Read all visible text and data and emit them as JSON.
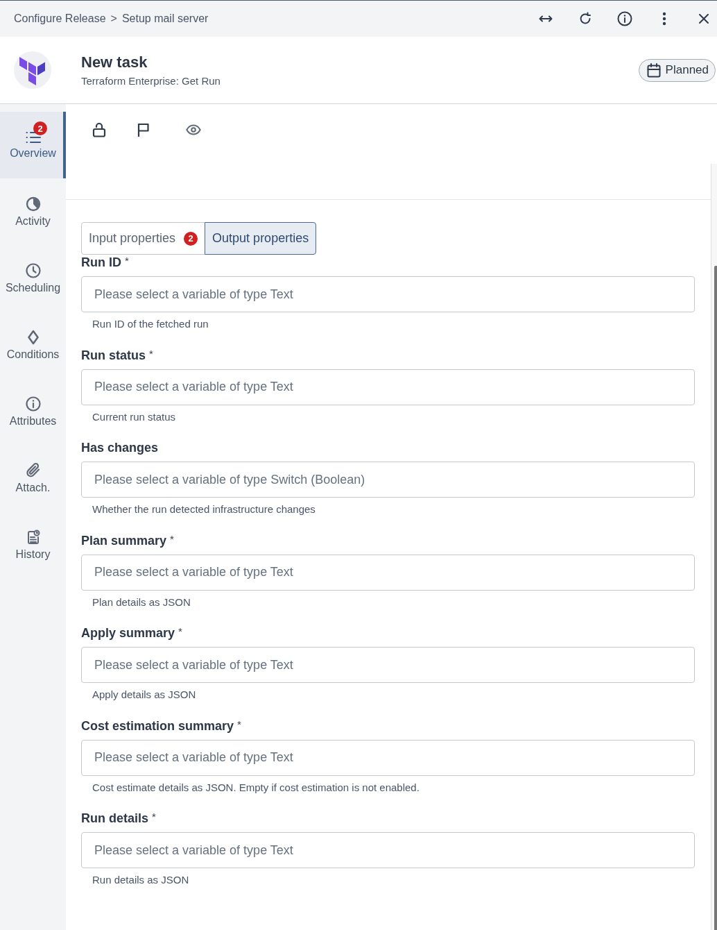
{
  "breadcrumb": {
    "items": [
      "Configure Release",
      "Setup mail server"
    ],
    "separator": ">"
  },
  "task": {
    "title": "New task",
    "subtitle": "Terraform Enterprise: Get Run",
    "status": "Planned"
  },
  "sidebar": {
    "items": [
      {
        "label": "Overview",
        "badge": "2",
        "selected": true
      },
      {
        "label": "Activity",
        "selected": false
      },
      {
        "label": "Scheduling",
        "selected": false
      },
      {
        "label": "Conditions",
        "selected": false
      },
      {
        "label": "Attributes",
        "selected": false
      },
      {
        "label": "Attach.",
        "selected": false
      },
      {
        "label": "History",
        "selected": false
      }
    ]
  },
  "tabs": [
    {
      "label": "Input properties",
      "badge": "2",
      "selected": false
    },
    {
      "label": "Output properties",
      "selected": true
    }
  ],
  "fields": [
    {
      "label": "Run ID",
      "required_mark": "*",
      "placeholder": "Please select a variable of type Text",
      "help": "Run ID of the fetched run"
    },
    {
      "label": "Run status",
      "required_mark": "*",
      "placeholder": "Please select a variable of type Text",
      "help": "Current run status"
    },
    {
      "label": "Has changes",
      "placeholder": "Please select a variable of type Switch (Boolean)",
      "help": "Whether the run detected infrastructure changes"
    },
    {
      "label": "Plan summary",
      "required_mark": "*",
      "placeholder": "Please select a variable of type Text",
      "help": "Plan details as JSON"
    },
    {
      "label": "Apply summary",
      "required_mark": "*",
      "placeholder": "Please select a variable of type Text",
      "help": "Apply details as JSON"
    },
    {
      "label": "Cost estimation summary",
      "required_mark": "*",
      "placeholder": "Please select a variable of type Text",
      "help": "Cost estimate details as JSON. Empty if cost estimation is not enabled."
    },
    {
      "label": "Run details",
      "required_mark": "*",
      "placeholder": "Please select a variable of type Text",
      "help": "Run details as JSON"
    }
  ]
}
